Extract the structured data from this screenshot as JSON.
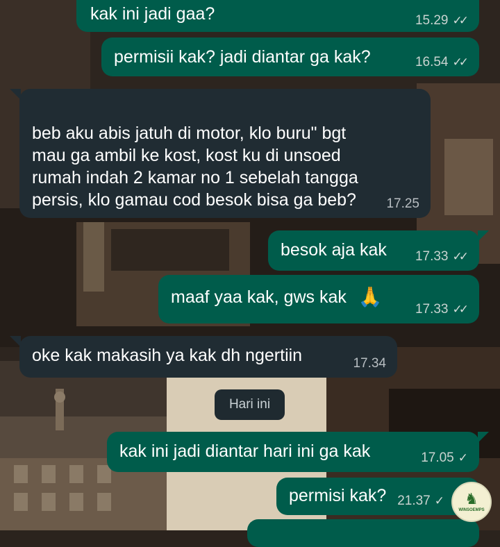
{
  "messages": [
    {
      "id": "m1",
      "dir": "out",
      "text": "kak ini jadi gaa?",
      "time": "15.29",
      "status": "read"
    },
    {
      "id": "m2",
      "dir": "out",
      "text": "permisii kak? jadi diantar ga kak?",
      "time": "16.54",
      "status": "read"
    },
    {
      "id": "m3",
      "dir": "in",
      "text": "beb aku abis jatuh di motor, klo buru\" bgt\nmau ga ambil ke kost, kost ku di unsoed\nrumah indah 2 kamar no 1 sebelah tangga\npersis, klo gamau cod besok bisa ga beb?",
      "time": "17.25"
    },
    {
      "id": "m4",
      "dir": "out",
      "text": "besok aja kak",
      "time": "17.33",
      "status": "read"
    },
    {
      "id": "m5",
      "dir": "out",
      "text": "maaf yaa kak, gws kak",
      "emoji": "🙏",
      "time": "17.33",
      "status": "read"
    },
    {
      "id": "m6",
      "dir": "in",
      "text": "oke kak makasih ya kak dh ngertiin",
      "time": "17.34"
    },
    {
      "id": "m7",
      "dir": "out",
      "text": "kak ini jadi diantar hari ini ga kak",
      "time": "17.05",
      "status": "sent"
    },
    {
      "id": "m8",
      "dir": "out",
      "text": "permisi kak?",
      "time": "21.37",
      "status": "sent"
    }
  ],
  "day_separator": "Hari ini",
  "avatar": {
    "icon": "horse-rider-icon",
    "label": "WINSOEMPS"
  },
  "colors": {
    "outgoing": "#005c4b",
    "incoming": "#202c33",
    "text": "#ffffff"
  }
}
